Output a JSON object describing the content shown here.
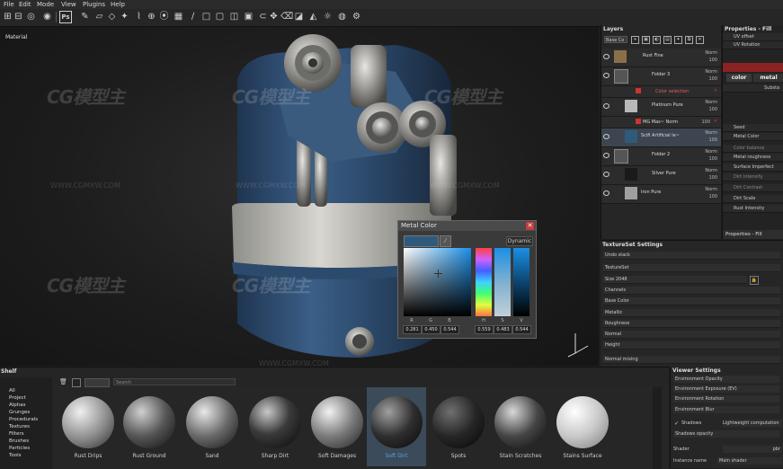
{
  "menu": [
    "File",
    "Edit",
    "Mode",
    "View",
    "Plugins",
    "Help"
  ],
  "toolbar": {
    "ps_label": "Ps"
  },
  "viewport": {
    "label": "Material"
  },
  "watermarks": {
    "brand": "CG模型主",
    "url": "WWW.CGMXW.COM"
  },
  "color_picker": {
    "title": "Metal Color",
    "mode_label": "Dynamic",
    "channel_labels": [
      "R",
      "G",
      "B",
      "H",
      "S",
      "V"
    ],
    "channel_values": [
      "0.281",
      "0.450",
      "0.544",
      "0.559",
      "0.483",
      "0.544"
    ],
    "swatch_color": "#2f5a7c"
  },
  "layers": {
    "title": "Layers",
    "blend_mode": "Base Co",
    "rows": [
      {
        "name": "Rust Fine",
        "blend": "Norm",
        "opacity": "100"
      },
      {
        "name": "Folder 3",
        "blend": "Norm",
        "opacity": "100"
      },
      {
        "name": "Color selection",
        "blend": "",
        "opacity": ""
      },
      {
        "name": "Platinum Pure",
        "blend": "Norm",
        "opacity": "100"
      },
      {
        "name": "MG Mas~ Norm",
        "blend": "",
        "opacity": "100"
      },
      {
        "name": "Scifi Artificial le~",
        "blend": "Norm",
        "opacity": "100"
      },
      {
        "name": "Folder 2",
        "blend": "Norm",
        "opacity": "100"
      },
      {
        "name": "Silver Pure",
        "blend": "Norm",
        "opacity": "100"
      },
      {
        "name": "Iron Pure",
        "blend": "Norm",
        "opacity": "100"
      }
    ]
  },
  "properties": {
    "title": "Properties - Fill",
    "footer": "Properties - Fill",
    "rows": [
      "UV offset",
      "UV Rotation",
      "color",
      "metal",
      "Substa",
      "Seed",
      "Metal Color",
      "Color balance",
      "Metal roughness",
      "Surface Imperfect",
      "Dirt Intensity",
      "Dirt Contrast",
      "Dirt Scale",
      "Rust Intensity"
    ]
  },
  "texture_set": {
    "title": "TextureSet Settings",
    "rows": [
      "Undo stack",
      "TextureSet",
      "Size 2048",
      "Channels",
      "Base Color",
      "Metallic",
      "Roughness",
      "Normal",
      "Height",
      "Normal mixing"
    ]
  },
  "shelf": {
    "title": "Shelf",
    "categories": [
      "All",
      "Project",
      "Alphas",
      "Grunges",
      "Procedurals",
      "Textures",
      "Filters",
      "Brushes",
      "Particles",
      "Tools"
    ],
    "search_placeholder": "Search",
    "materials": [
      "Rust Drips",
      "Rust Ground",
      "Sand",
      "Sharp Dirt",
      "Soft Damages",
      "Soft Dirt",
      "Spots",
      "Stain Scratches",
      "Stains Surface"
    ],
    "selected_material": "Soft Dirt",
    "selected_color": "#5aa0d8"
  },
  "viewer_settings": {
    "title": "Viewer Settings",
    "rows": [
      "Environment Opacity",
      "Environment Exposure (EV)",
      "Environment Rotation",
      "Environment Blur",
      "Shadows",
      "Shadows opacity",
      "Shader",
      "Instance name"
    ],
    "shadows_value": "Lightweight computation",
    "shader_value": "pbr",
    "instance_value": "Main shader"
  }
}
